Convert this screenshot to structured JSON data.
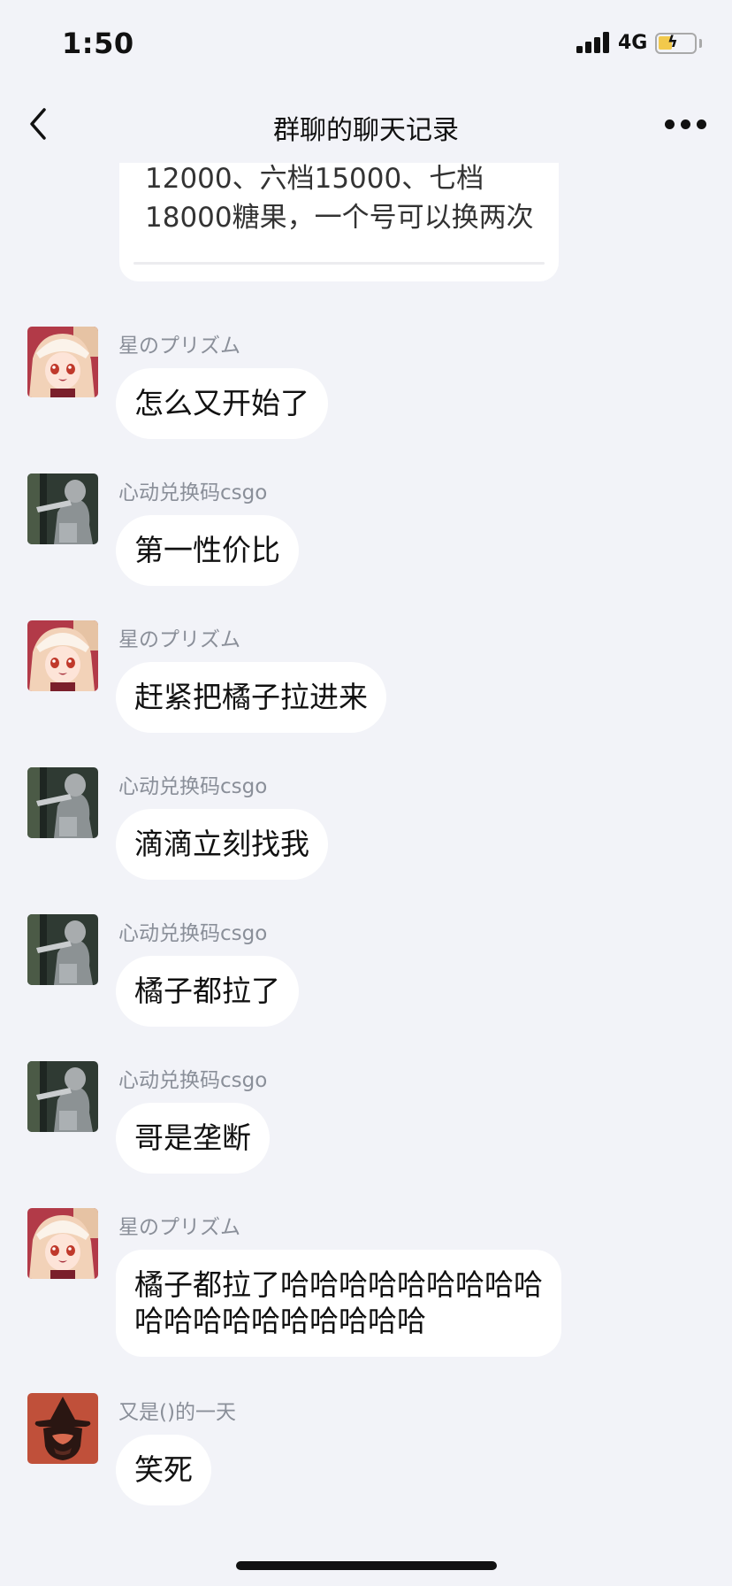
{
  "status_bar": {
    "time": "1:50",
    "network": "4G",
    "battery_color": "#f2c94c"
  },
  "nav": {
    "title": "群聊的聊天记录",
    "back_icon": "chevron-left-icon",
    "more_icon": "more-dots-icon"
  },
  "forwarded_card": {
    "text": "12000、六档15000、七档18000糖果，一个号可以换两次"
  },
  "messages": [
    {
      "sender": "星のプリズム",
      "text": "怎么又开始了",
      "avatar": "anime-girl-avatar"
    },
    {
      "sender": "心动兑换码csgo",
      "text": "第一性价比",
      "avatar": "dark-figure-avatar"
    },
    {
      "sender": "星のプリズム",
      "text": "赶紧把橘子拉进来",
      "avatar": "anime-girl-avatar"
    },
    {
      "sender": "心动兑换码csgo",
      "text": "滴滴立刻找我",
      "avatar": "dark-figure-avatar"
    },
    {
      "sender": "心动兑换码csgo",
      "text": "橘子都拉了",
      "avatar": "dark-figure-avatar"
    },
    {
      "sender": "心动兑换码csgo",
      "text": "哥是垄断",
      "avatar": "dark-figure-avatar"
    },
    {
      "sender": "星のプリズム",
      "text_line1": "橘子都拉了哈哈哈哈哈哈哈哈哈",
      "text_line2": "哈哈哈哈哈哈哈哈哈哈",
      "avatar": "anime-girl-avatar"
    },
    {
      "sender": "又是()的一天",
      "text": "笑死",
      "avatar": "witch-silhouette-avatar"
    }
  ]
}
